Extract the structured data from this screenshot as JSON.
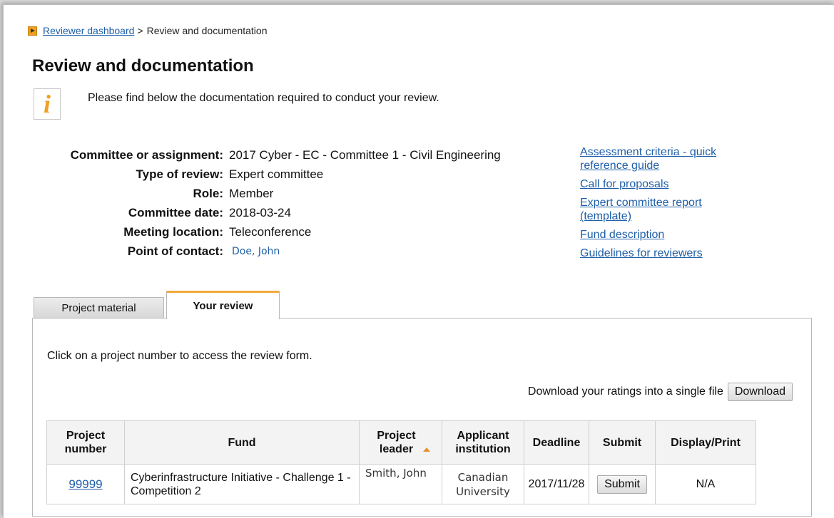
{
  "breadcrumb": {
    "link": "Reviewer dashboard",
    "separator": ">",
    "current": "Review and documentation"
  },
  "page_title": "Review and documentation",
  "info": {
    "icon": "info-icon",
    "text": "Please find below the documentation required to conduct your review."
  },
  "details": [
    {
      "label": "Committee or assignment:",
      "value": "2017 Cyber - EC - Committee 1 - Civil Engineering"
    },
    {
      "label": "Type of review:",
      "value": "Expert committee"
    },
    {
      "label": "Role:",
      "value": "Member"
    },
    {
      "label": "Committee date:",
      "value": "2018-03-24"
    },
    {
      "label": "Meeting location:",
      "value": "Teleconference"
    },
    {
      "label": "Point of contact:",
      "value": "Doe, John"
    }
  ],
  "links": [
    "Assessment criteria - quick reference guide",
    "Call for proposals",
    "Expert committee report (template)",
    "Fund description",
    "Guidelines for reviewers"
  ],
  "tabs": [
    {
      "label": "Project material",
      "active": false
    },
    {
      "label": "Your review",
      "active": true
    }
  ],
  "panel": {
    "note": "Click on a project number to access the review form.",
    "download_text": "Download your ratings into a single file",
    "download_button": "Download"
  },
  "table": {
    "headers": [
      "Project number",
      "Fund",
      "Project leader",
      "Applicant institution",
      "Deadline",
      "Submit",
      "Display/Print"
    ],
    "rows": [
      {
        "project_number": "99999",
        "fund": "Cyberinfrastructure Initiative - Challenge 1 - Competition 2",
        "leader": "Smith, John",
        "institution": "Canadian University",
        "deadline": "2017/11/28",
        "submit": "Submit",
        "display": "N/A"
      }
    ]
  },
  "colors": {
    "link": "#1f5fa8",
    "accent": "#f2a93b"
  }
}
